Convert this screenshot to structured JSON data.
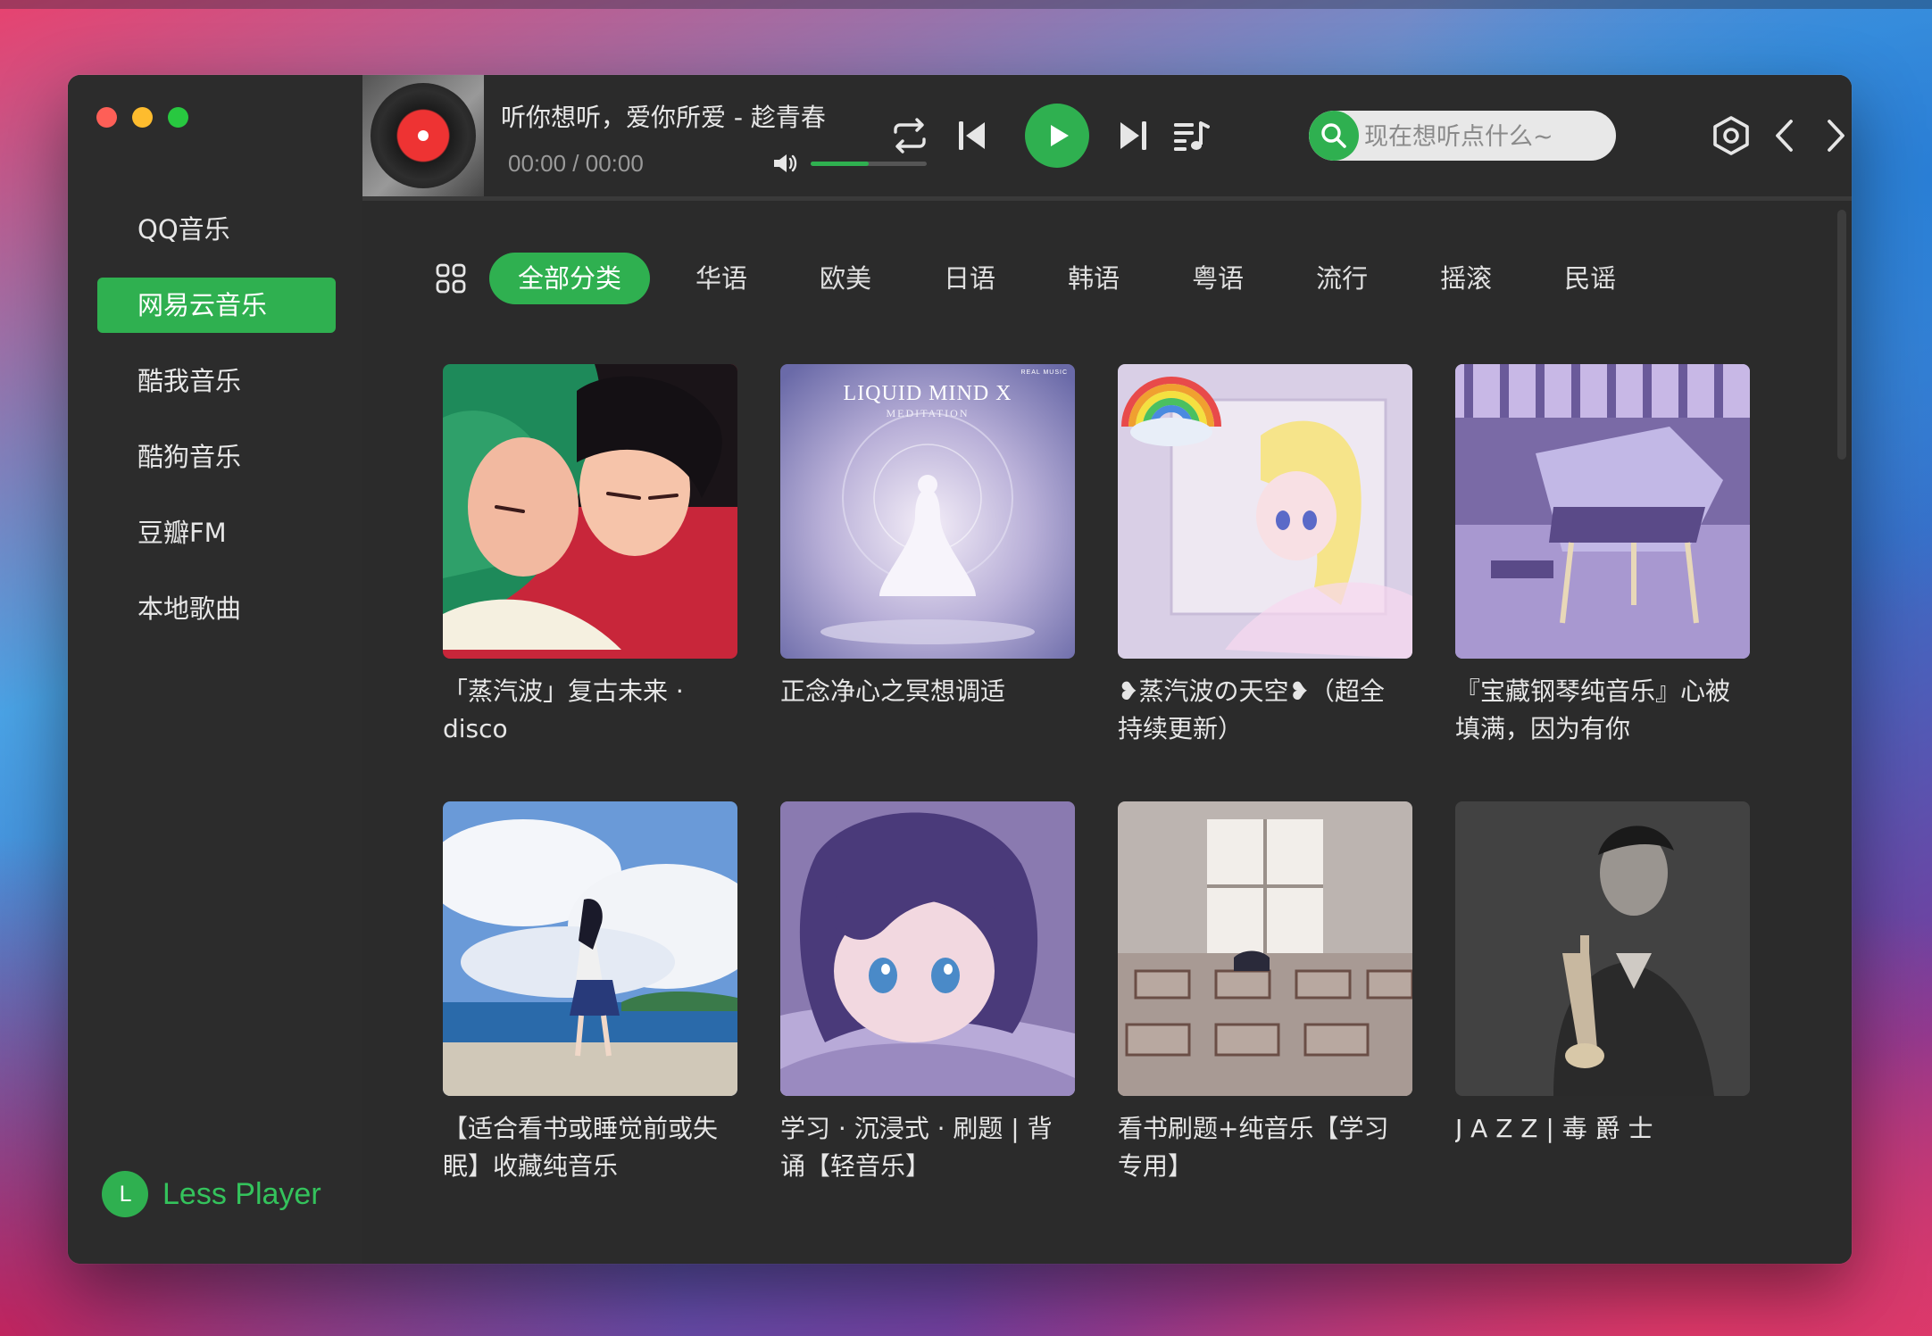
{
  "app": {
    "brand_name": "Less Player",
    "brand_logo_letter": "L"
  },
  "sidebar": {
    "items": [
      {
        "label": "QQ音乐",
        "active": false
      },
      {
        "label": "网易云音乐",
        "active": true
      },
      {
        "label": "酷我音乐",
        "active": false
      },
      {
        "label": "酷狗音乐",
        "active": false
      },
      {
        "label": "豆瓣FM",
        "active": false
      },
      {
        "label": "本地歌曲",
        "active": false
      }
    ]
  },
  "player": {
    "song_title": "听你想听，爱你所爱 - 趁青春",
    "time": "00:00 / 00:00",
    "volume": 0.5
  },
  "search": {
    "placeholder": "现在想听点什么~"
  },
  "categories": {
    "items": [
      "全部分类",
      "华语",
      "欧美",
      "日语",
      "韩语",
      "粤语",
      "流行",
      "摇滚",
      "民谣"
    ],
    "active": "全部分类"
  },
  "playlists": [
    {
      "title": "「蒸汽波」复古未来 · disco"
    },
    {
      "title": "正念净心之冥想调适",
      "cover_text_1": "LIQUID MIND X",
      "cover_text_2": "MEDITATION",
      "cover_text_3": "REAL MUSIC"
    },
    {
      "title": "❥蒸汽波の天空❥（超全 持续更新）"
    },
    {
      "title": "『宝藏钢琴纯音乐』心被填满，因为有你"
    },
    {
      "title": "【适合看书或睡觉前或失眠】收藏纯音乐"
    },
    {
      "title": "学习 · 沉浸式 · 刷题 | 背诵【轻音乐】"
    },
    {
      "title": "看书刷题+纯音乐【学习专用】"
    },
    {
      "title": "J A Z Z | 毒 爵 士"
    }
  ],
  "colors": {
    "accent": "#2fb050",
    "window_bg": "#2b2b2b",
    "sidebar_bg": "#2c2c2c"
  }
}
